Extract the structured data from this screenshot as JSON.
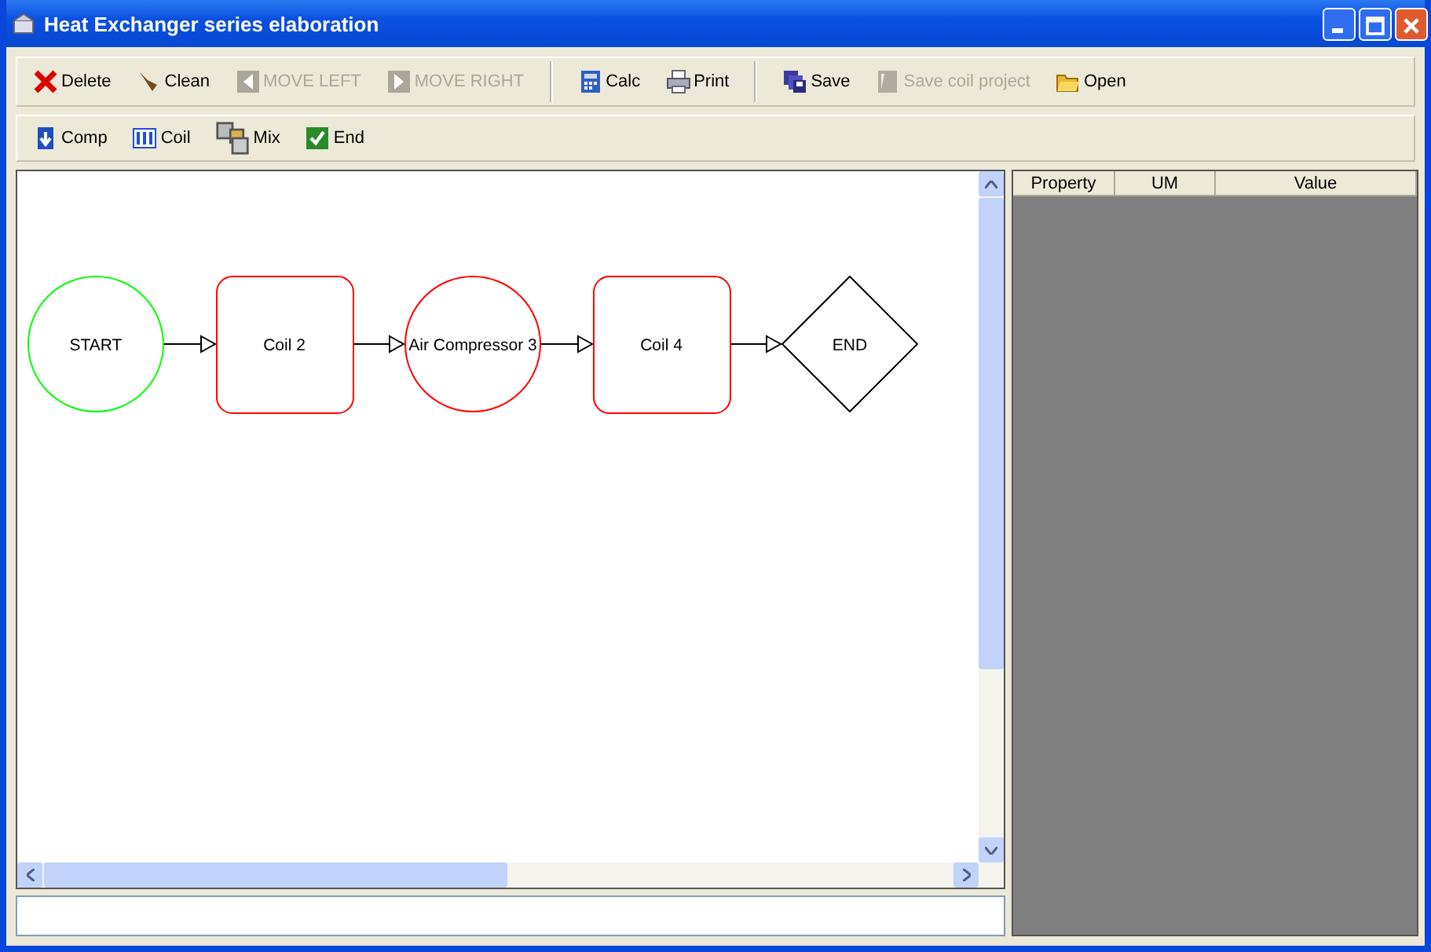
{
  "window": {
    "title": "Heat Exchanger series elaboration"
  },
  "toolbar": {
    "groups": [
      [
        {
          "label": "Delete",
          "disabled": false
        },
        {
          "label": "Clean",
          "disabled": false
        },
        {
          "label": "MOVE LEFT",
          "disabled": true
        },
        {
          "label": "MOVE RIGHT",
          "disabled": true
        }
      ],
      [
        {
          "label": "Calc",
          "disabled": false
        },
        {
          "label": "Print",
          "disabled": false
        }
      ],
      [
        {
          "label": "Save",
          "disabled": false
        },
        {
          "label": "Save coil project",
          "disabled": true
        },
        {
          "label": "Open",
          "disabled": false
        }
      ]
    ]
  },
  "palette": [
    {
      "label": "Comp"
    },
    {
      "label": "Coil"
    },
    {
      "label": "Mix"
    },
    {
      "label": "End"
    }
  ],
  "diagram": {
    "nodes": [
      {
        "label": "START",
        "kind": "circle",
        "color": "#00ff00"
      },
      {
        "label": "Coil 2",
        "kind": "rect",
        "color": "#ff0000"
      },
      {
        "label": "Air Compressor 3",
        "kind": "circle",
        "color": "#ff0000"
      },
      {
        "label": "Coil 4",
        "kind": "rect",
        "color": "#ff0000"
      },
      {
        "label": "END",
        "kind": "diamond",
        "color": "#000000"
      }
    ]
  },
  "properties": {
    "columns": [
      "Property",
      "UM",
      "Value"
    ]
  }
}
